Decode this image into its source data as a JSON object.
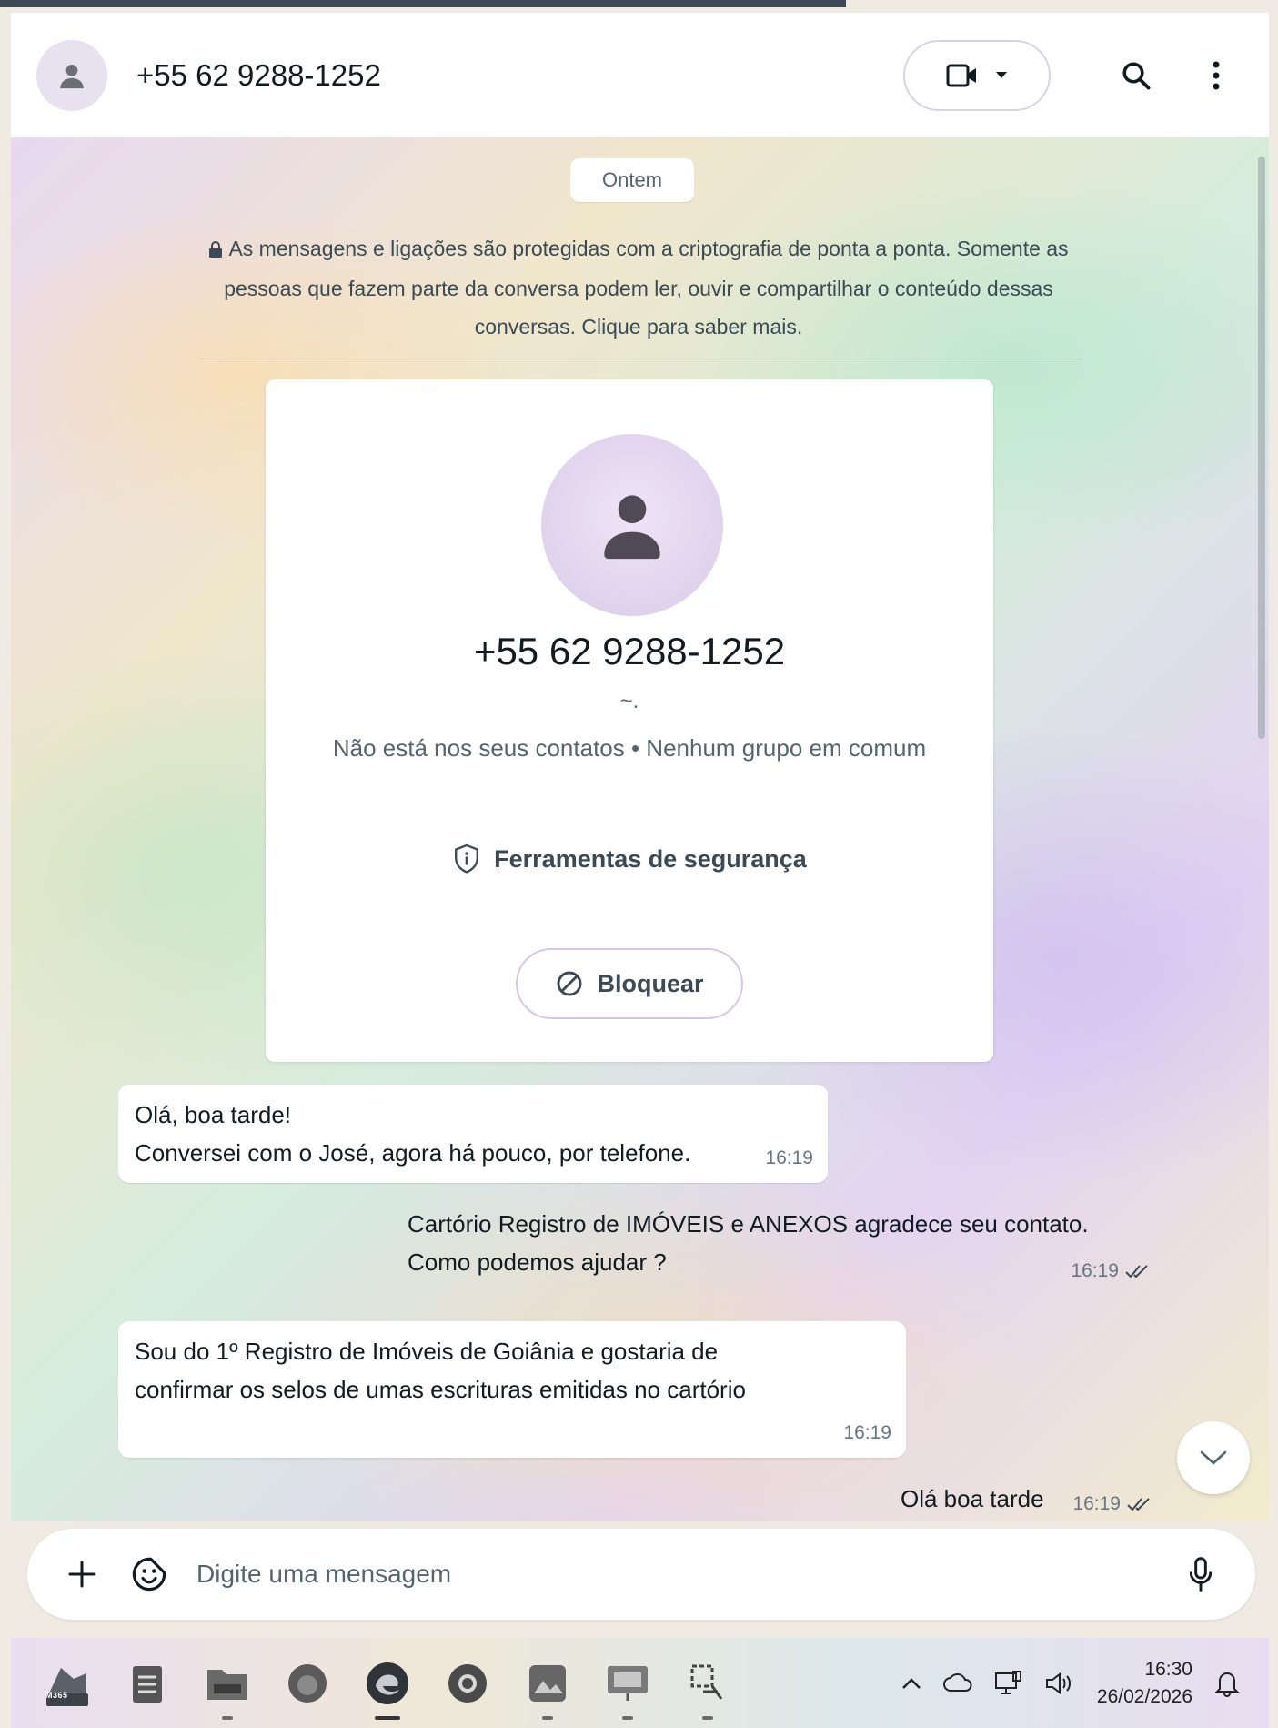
{
  "header": {
    "contact_name": "+55 62 9288-1252",
    "icons": [
      "avatar-icon",
      "video-call-icon",
      "dropdown-icon",
      "search-icon",
      "menu-icon"
    ]
  },
  "chat": {
    "day_label": "Ontem",
    "encryption_notice": "As mensagens e ligações são protegidas com a criptografia de ponta a ponta. Somente as pessoas que fazem parte da conversa podem ler, ouvir e compartilhar o conteúdo dessas conversas. Clique para saber mais.",
    "info_card": {
      "phone": "+55 62 9288-1252",
      "about": "~.",
      "status": "Não está nos seus contatos • Nenhum grupo em comum",
      "safety_tools": "Ferramentas de segurança",
      "block_label": "Bloquear"
    },
    "messages": [
      {
        "direction": "in",
        "text": "Olá, boa tarde!\nConversei com o José, agora há pouco, por telefone.",
        "time": "16:19"
      },
      {
        "direction": "out",
        "text": "Cartório Registro de IMÓVEIS e  ANEXOS agradece seu contato.\nComo podemos ajudar ?",
        "time": "16:19"
      },
      {
        "direction": "in",
        "text": "Sou do 1º Registro de Imóveis de Goiânia e gostaria de\nconfirmar os selos de umas escrituras emitidas no cartório",
        "time": "16:19"
      },
      {
        "direction": "out",
        "text": "Olá boa tarde",
        "time": "16:19"
      }
    ]
  },
  "composer": {
    "placeholder": "Digite uma mensagem"
  },
  "taskbar": {
    "time": "16:30",
    "date": "26/02/2026",
    "app_badge": "M365"
  },
  "colors": {
    "accent": "#8a6fb0",
    "tick": "#53bdeb"
  }
}
